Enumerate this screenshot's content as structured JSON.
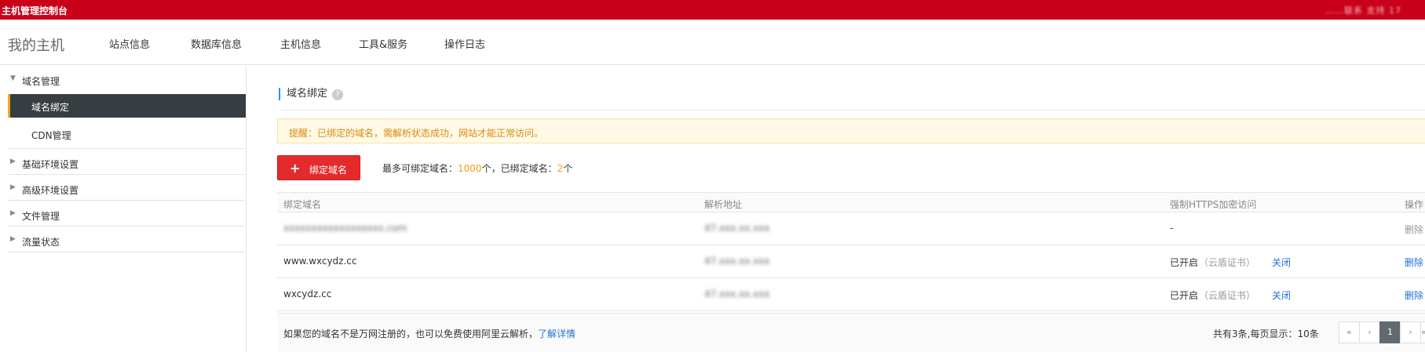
{
  "topbar": {
    "title": "主机管理控制台",
    "right_text": "……联系 支持 17"
  },
  "nav": {
    "brand": "我的主机",
    "items": [
      "站点信息",
      "数据库信息",
      "主机信息",
      "工具&服务",
      "操作日志"
    ]
  },
  "sidebar": {
    "groups": [
      {
        "label": "域名管理",
        "expanded": true
      },
      {
        "label": "基础环境设置",
        "expanded": false
      },
      {
        "label": "高级环境设置",
        "expanded": false
      },
      {
        "label": "文件管理",
        "expanded": false
      },
      {
        "label": "流量状态",
        "expanded": false
      }
    ],
    "active_item": "域名绑定",
    "sub_item": "CDN管理"
  },
  "main": {
    "section_title": "域名绑定",
    "help_glyph": "?",
    "alert": "提醒：已绑定的域名，需解析状态成功，网站才能正常访问。",
    "bind_button": {
      "icon": "+",
      "label": "绑定域名"
    },
    "quota": {
      "prefix": "最多可绑定域名：",
      "max": "1000",
      "mid": "个，已绑定域名：",
      "bound": "2",
      "suffix": "个"
    }
  },
  "table": {
    "headers": [
      "绑定域名",
      "解析地址",
      "强制HTTPS加密访问",
      "操作"
    ],
    "rows": [
      {
        "domain": "xxxxxxxxxxxxxxxxxx.com",
        "address": "47.xxx.xx.xxx",
        "https_status": "-",
        "cert": "",
        "toggle": "",
        "action": "删除",
        "blurred": true,
        "action_disabled": true
      },
      {
        "domain": "www.wxcydz.cc",
        "address": "47.xxx.xx.xxx",
        "https_status": "已开启",
        "cert": "（云盾证书）",
        "toggle": "关闭",
        "action": "删除",
        "blurred": false,
        "action_disabled": false
      },
      {
        "domain": "wxcydz.cc",
        "address": "47.xxx.xx.xxx",
        "https_status": "已开启",
        "cert": "（云盾证书）",
        "toggle": "关闭",
        "action": "删除",
        "blurred": false,
        "action_disabled": false
      }
    ]
  },
  "footer": {
    "note": "如果您的域名不是万网注册的，也可以免费使用阿里云解析，",
    "note_link": "了解详情",
    "total": "共有3条,每页显示：10条",
    "pager": [
      "«",
      "‹",
      "1",
      "›",
      "»"
    ],
    "current_page": "1"
  },
  "colors": {
    "topbar": "#c9001a",
    "accent_orange": "#f5a623",
    "primary_red": "#e42b2b",
    "link_blue": "#2272d6"
  }
}
